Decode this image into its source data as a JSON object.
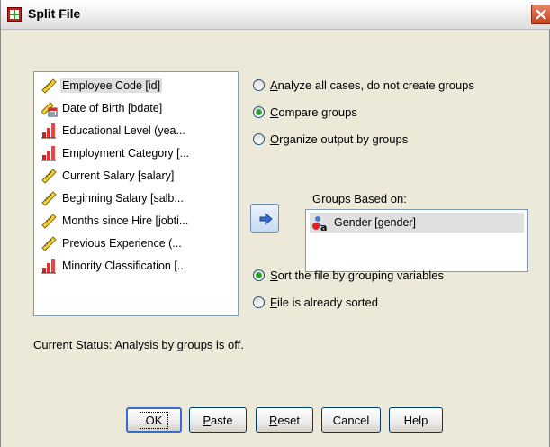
{
  "window": {
    "title": "Split File"
  },
  "variables": [
    {
      "label": "Employee Code [id]",
      "icon": "scale-ruler-icon",
      "selected": true
    },
    {
      "label": "Date of Birth [bdate]",
      "icon": "date-scale-icon",
      "selected": false
    },
    {
      "label": "Educational Level (yea...",
      "icon": "ordinal-bars-icon",
      "selected": false
    },
    {
      "label": "Employment Category [...",
      "icon": "ordinal-bars-icon",
      "selected": false
    },
    {
      "label": "Current Salary [salary]",
      "icon": "scale-ruler-icon",
      "selected": false
    },
    {
      "label": "Beginning Salary [salb...",
      "icon": "scale-ruler-icon",
      "selected": false
    },
    {
      "label": "Months since Hire [jobti...",
      "icon": "scale-ruler-icon",
      "selected": false
    },
    {
      "label": "Previous Experience (...",
      "icon": "scale-ruler-icon",
      "selected": false
    },
    {
      "label": "Minority Classification [...",
      "icon": "ordinal-bars-icon",
      "selected": false
    }
  ],
  "options": {
    "analyze_all": {
      "pre": "",
      "key": "A",
      "post": "nalyze all cases, do not create groups",
      "checked": false
    },
    "compare": {
      "pre": "",
      "key": "C",
      "post": "ompare groups",
      "checked": true
    },
    "organize": {
      "pre": "",
      "key": "O",
      "post": "rganize output by groups",
      "checked": false
    }
  },
  "groups": {
    "label": "Groups Based on:",
    "items": [
      {
        "label": "Gender [gender]",
        "icon": "nominal-person-icon"
      }
    ]
  },
  "sort": {
    "sort_file": {
      "pre": "",
      "key": "S",
      "post": "ort the file by grouping variables",
      "checked": true
    },
    "already_sorted": {
      "pre": "",
      "key": "F",
      "post": "ile is already sorted",
      "checked": false
    }
  },
  "status": "Current Status: Analysis by groups is off.",
  "buttons": {
    "ok": "OK",
    "paste_pre": "",
    "paste_key": "P",
    "paste_post": "aste",
    "reset_pre": "",
    "reset_key": "R",
    "reset_post": "eset",
    "cancel": "Cancel",
    "help": "Help"
  },
  "colors": {
    "accent": "#3a6ccf",
    "selection": "#e0e0e0"
  }
}
